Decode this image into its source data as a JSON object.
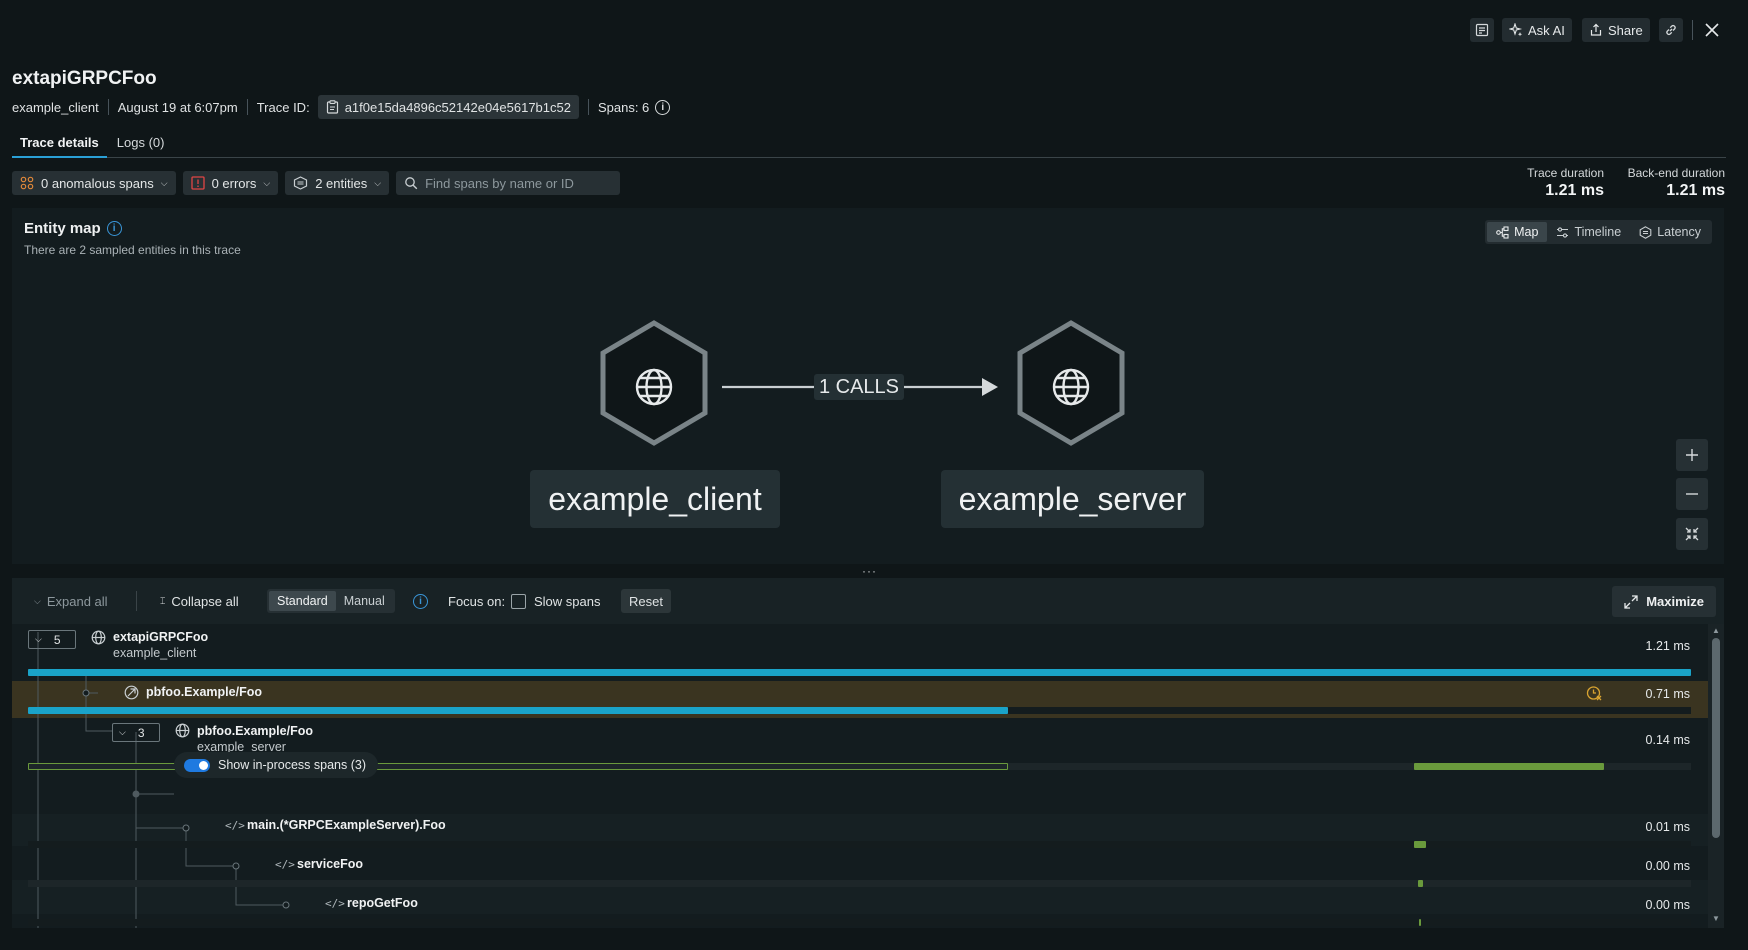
{
  "toolbar": {
    "ask_ai_label": "Ask AI",
    "share_label": "Share"
  },
  "header": {
    "title": "extapiGRPCFoo",
    "entity": "example_client",
    "timestamp": "August 19 at 6:07pm",
    "trace_id_label": "Trace ID:",
    "trace_id": "a1f0e15da4896c52142e04e5617b1c52",
    "spans_label": "Spans: 6"
  },
  "tabs": [
    {
      "label": "Trace details",
      "active": true
    },
    {
      "label": "Logs (0)",
      "active": false
    }
  ],
  "filters": {
    "anomalous": "0 anomalous spans",
    "errors": "0 errors",
    "entities": "2 entities",
    "search_placeholder": "Find spans by name or ID"
  },
  "durations": {
    "trace_label": "Trace duration",
    "trace_value": "1.21 ms",
    "backend_label": "Back-end duration",
    "backend_value": "1.21 ms"
  },
  "entity_map": {
    "title": "Entity map",
    "subtitle": "There are 2 sampled entities in this trace",
    "views": [
      "Map",
      "Timeline",
      "Latency"
    ],
    "active_view": "Map",
    "nodes": [
      {
        "label": "example_client"
      },
      {
        "label": "example_server"
      }
    ],
    "edge_label": "1 CALLS"
  },
  "spans_toolbar": {
    "expand_all": "Expand all",
    "collapse_all": "Collapse all",
    "modes": [
      "Standard",
      "Manual"
    ],
    "active_mode": "Standard",
    "focus_label": "Focus on:",
    "slow_spans_label": "Slow spans",
    "reset_label": "Reset",
    "maximize_label": "Maximize"
  },
  "spans": [
    {
      "name": "extapiGRPCFoo",
      "entity": "example_client",
      "duration": "1.21 ms",
      "count": "5"
    },
    {
      "name": "pbfoo.Example/Foo",
      "entity": "",
      "duration": "0.71 ms"
    },
    {
      "name": "pbfoo.Example/Foo",
      "entity": "example_server",
      "duration": "0.14 ms",
      "count": "3"
    },
    {
      "name": "main.(*GRPCExampleServer).Foo",
      "duration": "0.01 ms"
    },
    {
      "name": "serviceFoo",
      "duration": "0.00 ms"
    },
    {
      "name": "repoGetFoo",
      "duration": "0.00 ms"
    }
  ],
  "in_process_toggle": "Show in-process spans (3)",
  "colors": {
    "accent_blue": "#1aa3c8",
    "bar_green": "#6a9a3c",
    "highlight_row": "#3a3420",
    "anomaly_icon": "#d9a431"
  }
}
